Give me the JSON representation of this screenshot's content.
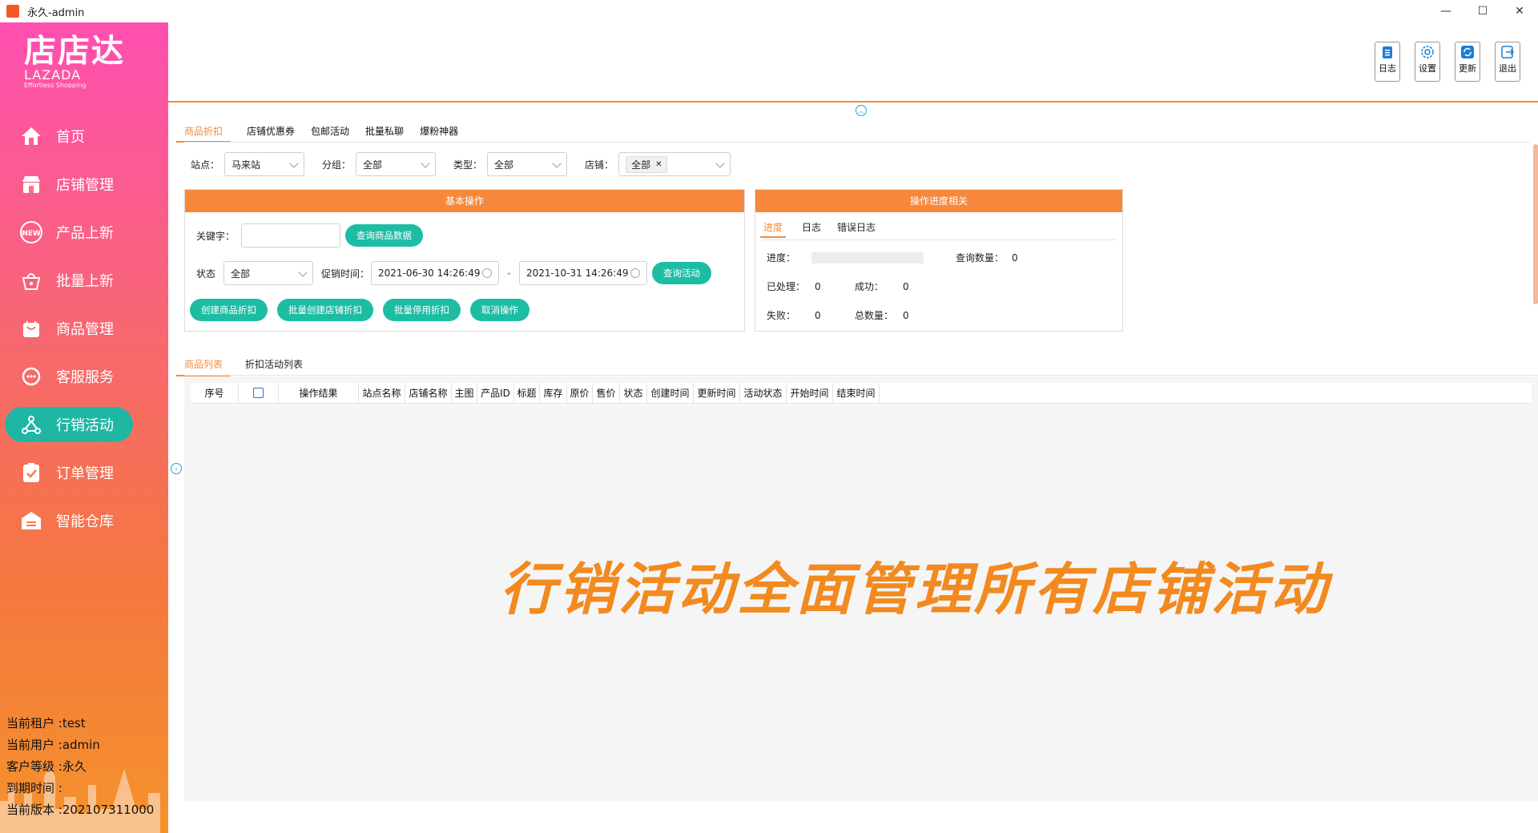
{
  "window": {
    "title": "永久-admin"
  },
  "logo": {
    "main": "店店达",
    "brand": "LAZADA",
    "tagline": "Effortless Shopping"
  },
  "sidebar": {
    "items": [
      {
        "label": "首页",
        "icon": "home-icon"
      },
      {
        "label": "店铺管理",
        "icon": "store-icon"
      },
      {
        "label": "产品上新",
        "icon": "new-badge-icon"
      },
      {
        "label": "批量上新",
        "icon": "basket-icon"
      },
      {
        "label": "商品管理",
        "icon": "bag-icon"
      },
      {
        "label": "客服服务",
        "icon": "chat-icon"
      },
      {
        "label": "行销活动",
        "icon": "network-icon",
        "active": true
      },
      {
        "label": "订单管理",
        "icon": "clipboard-check-icon"
      },
      {
        "label": "智能仓库",
        "icon": "warehouse-icon"
      }
    ]
  },
  "user_info": {
    "tenant": "当前租户 :test",
    "user": "当前用户 :admin",
    "level": "客户等级 :永久",
    "expire": "到期时间 :",
    "version": "当前版本 :202107311000"
  },
  "tools": [
    {
      "label": "日志",
      "icon": "log-icon"
    },
    {
      "label": "设置",
      "icon": "settings-icon"
    },
    {
      "label": "更新",
      "icon": "refresh-icon"
    },
    {
      "label": "退出",
      "icon": "exit-icon"
    }
  ],
  "tabs": [
    "商品折扣",
    "店铺优惠券",
    "包邮活动",
    "批量私聊",
    "爆粉神器"
  ],
  "filters": {
    "site_label": "站点：",
    "site_value": "马来站",
    "group_label": "分组：",
    "group_value": "全部",
    "type_label": "类型：",
    "type_value": "全部",
    "shop_label": "店铺：",
    "shop_chip": "全部"
  },
  "basic_panel": {
    "title": "基本操作",
    "keyword_label": "关键字：",
    "keyword_value": "",
    "query_goods_btn": "查询商品数据",
    "status_label": "状态",
    "status_value": "全部",
    "promo_time_label": "促销时间：",
    "start_date": "2021-06-30 14:26:49",
    "end_date": "2021-10-31 14:26:49",
    "dash": "-",
    "query_activity_btn": "查询活动",
    "buttons": [
      "创建商品折扣",
      "批量创建店铺折扣",
      "批量停用折扣",
      "取消操作"
    ]
  },
  "progress_panel": {
    "title": "操作进度相关",
    "tabs": [
      "进度",
      "日志",
      "错误日志"
    ],
    "progress_label": "进度：",
    "progress_fraction": 0,
    "query_count_label": "查询数量：",
    "query_count": "0",
    "processed_label": "已处理：",
    "processed": "0",
    "success_label": "成功：",
    "success": "0",
    "failed_label": "失败：",
    "failed": "0",
    "total_label": "总数量：",
    "total": "0"
  },
  "list_tabs": [
    "商品列表",
    "折扣活动列表"
  ],
  "table": {
    "columns": [
      "序号",
      "",
      "操作结果",
      "站点名称",
      "店铺名称",
      "主图",
      "产品ID",
      "标题",
      "库存",
      "原价",
      "售价",
      "状态",
      "创建时间",
      "更新时间",
      "活动状态",
      "开始时间",
      "结束时间"
    ]
  },
  "slogan": "行销活动全面管理所有店铺活动",
  "colors": {
    "accent": "#f28a3c",
    "teal": "#1dbda4",
    "panel_head": "#f7873b"
  }
}
